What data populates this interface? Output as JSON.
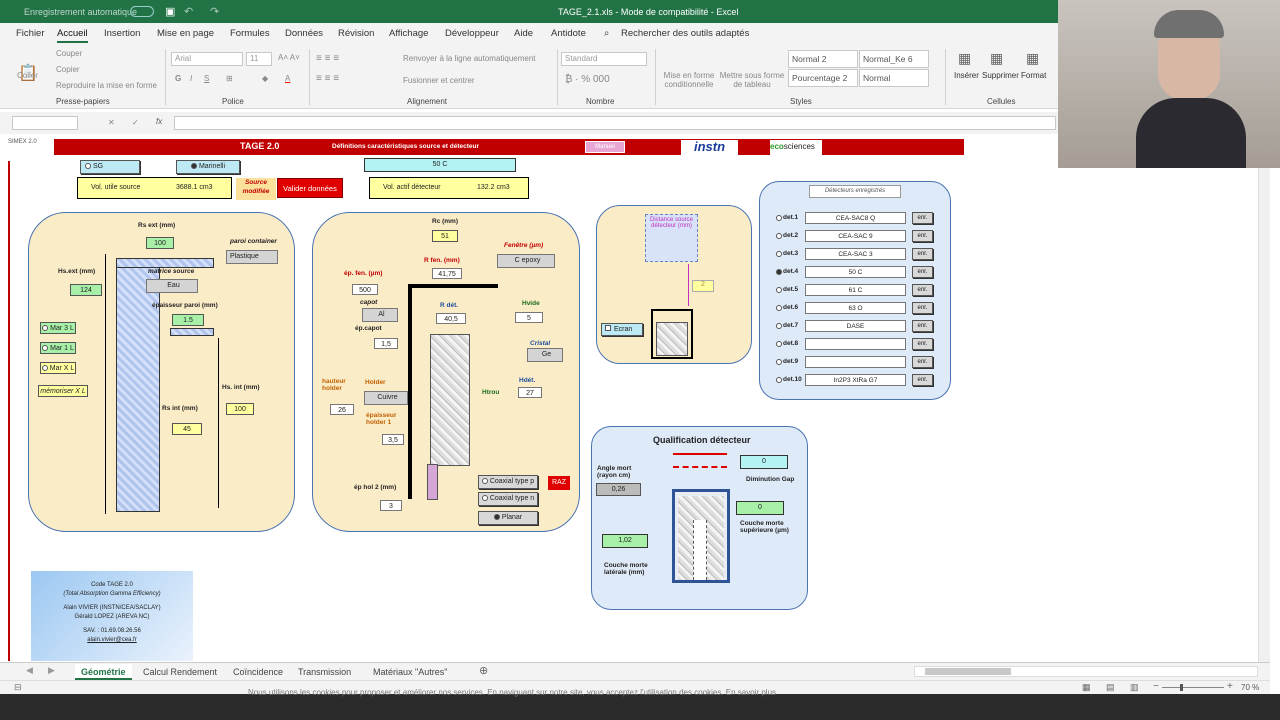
{
  "title": {
    "autosave": "Enregistrement automatique",
    "doc": "TAGE_2.1.xls  -  Mode de compatibilité  -  Excel"
  },
  "menu": [
    "Fichier",
    "Accueil",
    "Insertion",
    "Mise en page",
    "Formules",
    "Données",
    "Révision",
    "Affichage",
    "Développeur",
    "Aide",
    "Antidote"
  ],
  "search": "Rechercher des outils adaptés",
  "ribbon": {
    "couper": "Couper",
    "copier": "Copier",
    "reproduire": "Reproduire la mise en forme",
    "coller": "Coller",
    "font": "Arial",
    "size": "11",
    "wrap": "Renvoyer à la ligne automatiquement",
    "merge": "Fusionner et centrer",
    "format": "Standard",
    "mef_cond": "Mise en forme conditionnelle",
    "mef_tab": "Mettre sous forme de tableau",
    "styles": [
      "Normal 2",
      "Normal_Ke 6",
      "Pourcentage 2",
      "Normal"
    ],
    "inserer": "Insérer",
    "supprimer": "Supprimer",
    "formatbtn": "Format",
    "groups": [
      "Presse-papiers",
      "Police",
      "Alignement",
      "Nombre",
      "Styles",
      "Cellules"
    ]
  },
  "formula": {
    "fx": "fx"
  },
  "header": {
    "simex": "SIMEX 2.0",
    "tage": "TAGE 2.0",
    "defs": "Définitions caractéristiques source et détecteur",
    "manuel": "Manuel",
    "instn": "instn",
    "eco": "eco",
    "sciences": "sciences"
  },
  "source": {
    "sg": "SG",
    "marinelli": "Marinelli",
    "vol_utile": "Vol. utile source",
    "vol_utile_val": "3688.1 cm3",
    "source_modifiee": "Source modifiée",
    "valider": "Valider données",
    "rs_ext": "Rs ext (mm)",
    "rs_ext_val": "100",
    "paroi": "paroi container",
    "paroi_val": "Plastique",
    "hs_ext": "Hs.ext (mm)",
    "hs_ext_val": "124",
    "matrice": "matrice source",
    "matrice_val": "Eau",
    "epaisseur": "épaisseur paroi (mm)",
    "ep_val": "1.5",
    "mar3": "Mar 3 L",
    "mar1": "Mar 1 L",
    "marx": "Mar X L",
    "memoriser": "mémoriser X L",
    "hs_int": "Hs. int (mm)",
    "hs_int_val": "100",
    "rs_int": "Rs int (mm)",
    "rs_int_val": "45"
  },
  "detector": {
    "name": "50 C",
    "vol_actif": "Vol. actif détecteur",
    "vol_actif_val": "132.2 cm3",
    "rc": "Rc (mm)",
    "rc_val": "51",
    "fenetre": "Fenêtre (µm)",
    "fenetre_val": "C epoxy",
    "ep_fen": "ép. fen. (µm)",
    "ep_fen_val": "500",
    "r_fen": "R fen. (mm)",
    "r_fen_val": "41,75",
    "capot": "capot",
    "capot_val": "Al",
    "r_det": "R dét.",
    "r_det_val": "40,5",
    "hvide": "Hvide",
    "hvide_val": "5",
    "ep_capot": "ép.capot",
    "ep_capot_val": "1,5",
    "cristal": "Cristal",
    "cristal_val": "Ge",
    "hauteur_holder": "hauteur holder",
    "hauteur_val": "26",
    "holder": "Holder",
    "holder_val": "Cuivre",
    "ep_holder": "épaisseur holder 1",
    "ep_holder_val": "3,5",
    "hdet": "Hdét.",
    "hdet_val": "27",
    "htrou": "Htrou",
    "ep_hol2": "ép hol 2 (mm)",
    "ep_hol2_val": "3",
    "coax_p": "Coaxial type p",
    "coax_n": "Coaxial type n",
    "planar": "Planar",
    "raz": "RAZ"
  },
  "distance": {
    "label": "Distance source détecteur (mm)",
    "val": "2",
    "ecran": "Ecran"
  },
  "enregistres": {
    "title": "Détecteurs enregistrés",
    "rows": [
      {
        "id": "det.1",
        "name": "CEA-SAC8 Q"
      },
      {
        "id": "det.2",
        "name": "CEA-SAC 9"
      },
      {
        "id": "det.3",
        "name": "CEA-SAC 3"
      },
      {
        "id": "det.4",
        "name": "50 C"
      },
      {
        "id": "det.5",
        "name": "61 C"
      },
      {
        "id": "det.6",
        "name": "63 O"
      },
      {
        "id": "det.7",
        "name": "DASE"
      },
      {
        "id": "det.8",
        "name": ""
      },
      {
        "id": "det.9",
        "name": ""
      },
      {
        "id": "det.10",
        "name": "In2P3 XtRa G7"
      }
    ],
    "enr": "enr."
  },
  "qualif": {
    "title": "Qualification détecteur",
    "angle": "Angle mort (rayon cm)",
    "angle_val": "0,26",
    "gap_val": "0",
    "gap": "Diminution Gap",
    "sup_val": "0",
    "sup": "Couche morte supérieure (µm)",
    "lat_val": "1,02",
    "lat": "Couche morte latérale (mm)"
  },
  "code": {
    "l1": "Code TAGE 2.0",
    "l2": "(Total Absorption Gamma Efficiency)",
    "l3": "Alain VIVIER (INSTN/CEA/SACLAY)",
    "l4": "Gérald LOPEZ (AREVA NC)",
    "l5": "SAV. : 01.69.08.26.56",
    "l6": "alain.vivier@cea.fr"
  },
  "tabs": [
    "Géométrie",
    "Calcul Rendement",
    "Coïncidence",
    "Transmission",
    "Matériaux \"Autres\""
  ],
  "zoom": "70 %",
  "caption": "Nous utilisons les cookies pour proposer et améliorer nos services. En naviguant sur notre site, vous acceptez l'utilisation des cookies. En savoir plus"
}
